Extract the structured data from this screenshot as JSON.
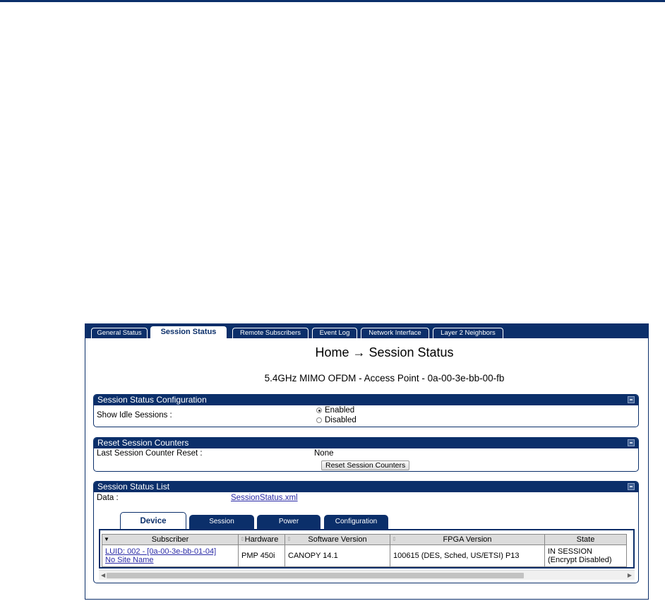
{
  "tabs": [
    {
      "label": "General Status",
      "active": false
    },
    {
      "label": "Session Status",
      "active": true
    },
    {
      "label": "Remote Subscribers",
      "active": false
    },
    {
      "label": "Event Log",
      "active": false
    },
    {
      "label": "Network Interface",
      "active": false
    },
    {
      "label": "Layer 2 Neighbors",
      "active": false
    }
  ],
  "page": {
    "title": "Home → Session Status",
    "subtitle": "5.4GHz MIMO OFDM - Access Point - 0a-00-3e-bb-00-fb"
  },
  "config_panel": {
    "header": "Session Status Configuration",
    "show_idle_label": "Show Idle Sessions :",
    "options": [
      "Enabled",
      "Disabled"
    ],
    "selected": "Enabled"
  },
  "reset_panel": {
    "header": "Reset Session Counters",
    "last_reset_label": "Last Session Counter Reset :",
    "last_reset_value": "None",
    "button_label": "Reset Session Counters"
  },
  "list_panel": {
    "header": "Session Status List",
    "data_label": "Data :",
    "data_link": "SessionStatus.xml",
    "subtabs": [
      {
        "label": "Device",
        "active": true
      },
      {
        "label": "Session",
        "active": false
      },
      {
        "label": "Power",
        "active": false
      },
      {
        "label": "Configuration",
        "active": false
      }
    ],
    "columns": [
      "Subscriber",
      "Hardware",
      "Software Version",
      "FPGA Version",
      "State"
    ],
    "rows": [
      {
        "subscriber_line1": "LUID: 002 - [0a-00-3e-bb-01-04]",
        "subscriber_line2": "No Site Name",
        "hardware": "PMP 450i",
        "software": "CANOPY 14.1",
        "fpga": "100615 (DES, Sched, US/ETSI) P13",
        "state_line1": "IN SESSION",
        "state_line2": "(Encrypt Disabled)"
      }
    ]
  },
  "colors": {
    "primary": "#0b2f6a",
    "link": "#2a2aa6"
  }
}
